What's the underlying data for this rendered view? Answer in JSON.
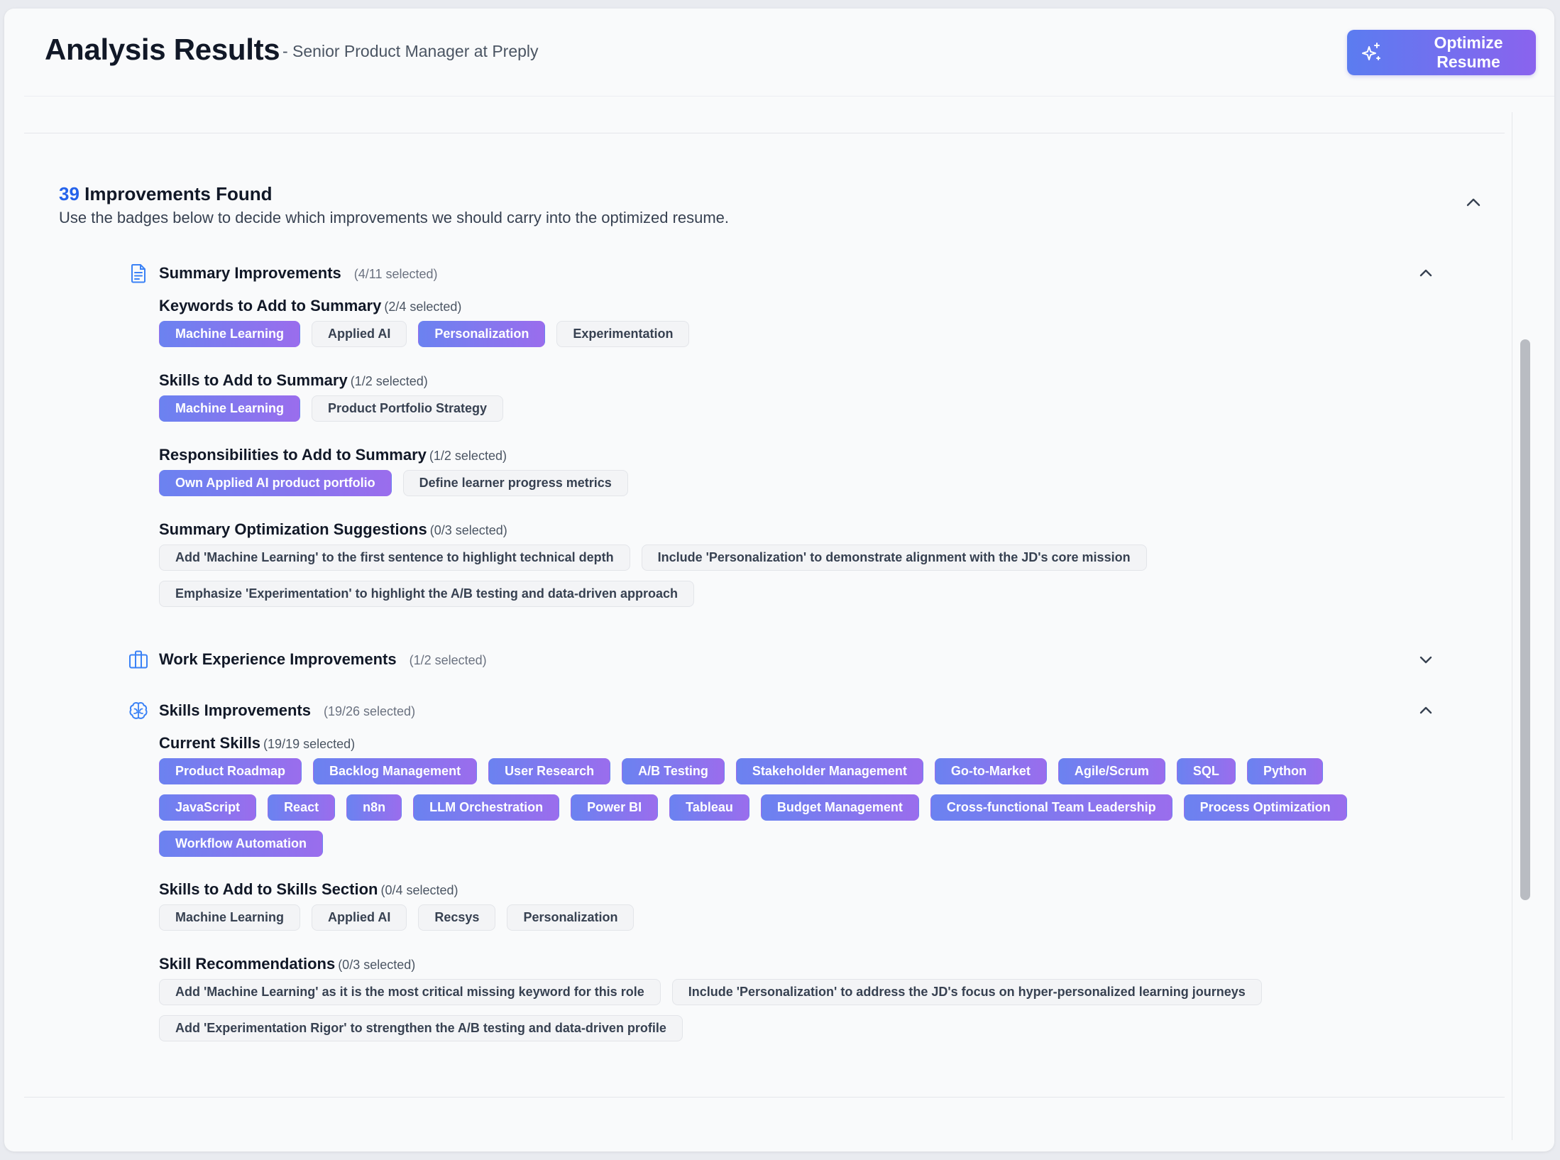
{
  "header": {
    "title": "Analysis Results",
    "subtitle": "- Senior Product Manager at Preply",
    "optimize_button": "Optimize Resume"
  },
  "improvements": {
    "count": "39",
    "title": "Improvements Found",
    "description": "Use the badges below to decide which improvements we should carry into the optimized resume."
  },
  "sections": {
    "summary": {
      "title": "Summary Improvements",
      "count": "(4/11 selected)",
      "groups": {
        "keywords": {
          "title": "Keywords to Add to Summary",
          "count": "(2/4 selected)",
          "badges": [
            {
              "label": "Machine Learning",
              "selected": true
            },
            {
              "label": "Applied AI",
              "selected": false
            },
            {
              "label": "Personalization",
              "selected": true
            },
            {
              "label": "Experimentation",
              "selected": false
            }
          ]
        },
        "skills": {
          "title": "Skills to Add to Summary",
          "count": "(1/2 selected)",
          "badges": [
            {
              "label": "Machine Learning",
              "selected": true
            },
            {
              "label": "Product Portfolio Strategy",
              "selected": false
            }
          ]
        },
        "responsibilities": {
          "title": "Responsibilities to Add to Summary",
          "count": "(1/2 selected)",
          "badges": [
            {
              "label": "Own Applied AI product portfolio",
              "selected": true
            },
            {
              "label": "Define learner progress metrics",
              "selected": false
            }
          ]
        },
        "suggestions": {
          "title": "Summary Optimization Suggestions",
          "count": "(0/3 selected)",
          "badges": [
            {
              "label": "Add 'Machine Learning' to the first sentence to highlight technical depth",
              "selected": false
            },
            {
              "label": "Include 'Personalization' to demonstrate alignment with the JD's core mission",
              "selected": false
            },
            {
              "label": "Emphasize 'Experimentation' to highlight the A/B testing and data-driven approach",
              "selected": false
            }
          ]
        }
      }
    },
    "work": {
      "title": "Work Experience Improvements",
      "count": "(1/2 selected)"
    },
    "skills": {
      "title": "Skills Improvements",
      "count": "(19/26 selected)",
      "groups": {
        "current": {
          "title": "Current Skills",
          "count": "(19/19 selected)",
          "badges": [
            {
              "label": "Product Roadmap",
              "selected": true
            },
            {
              "label": "Backlog Management",
              "selected": true
            },
            {
              "label": "User Research",
              "selected": true
            },
            {
              "label": "A/B Testing",
              "selected": true
            },
            {
              "label": "Stakeholder Management",
              "selected": true
            },
            {
              "label": "Go-to-Market",
              "selected": true
            },
            {
              "label": "Agile/Scrum",
              "selected": true
            },
            {
              "label": "SQL",
              "selected": true
            },
            {
              "label": "Python",
              "selected": true
            },
            {
              "label": "JavaScript",
              "selected": true
            },
            {
              "label": "React",
              "selected": true
            },
            {
              "label": "n8n",
              "selected": true
            },
            {
              "label": "LLM Orchestration",
              "selected": true
            },
            {
              "label": "Power BI",
              "selected": true
            },
            {
              "label": "Tableau",
              "selected": true
            },
            {
              "label": "Budget Management",
              "selected": true
            },
            {
              "label": "Cross-functional Team Leadership",
              "selected": true
            },
            {
              "label": "Process Optimization",
              "selected": true
            },
            {
              "label": "Workflow Automation",
              "selected": true
            }
          ]
        },
        "add": {
          "title": "Skills to Add to Skills Section",
          "count": "(0/4 selected)",
          "badges": [
            {
              "label": "Machine Learning",
              "selected": false
            },
            {
              "label": "Applied AI",
              "selected": false
            },
            {
              "label": "Recsys",
              "selected": false
            },
            {
              "label": "Personalization",
              "selected": false
            }
          ]
        },
        "recommendations": {
          "title": "Skill Recommendations",
          "count": "(0/3 selected)",
          "badges": [
            {
              "label": "Add 'Machine Learning' as it is the most critical missing keyword for this role",
              "selected": false
            },
            {
              "label": "Include 'Personalization' to address the JD's focus on hyper-personalized learning journeys",
              "selected": false
            },
            {
              "label": "Add 'Experimentation Rigor' to strengthen the A/B testing and data-driven profile",
              "selected": false
            }
          ]
        }
      }
    }
  },
  "colors": {
    "accent_blue": "#2563eb",
    "badge_gradient_start": "#6b82f0",
    "badge_gradient_end": "#9a6ded"
  }
}
